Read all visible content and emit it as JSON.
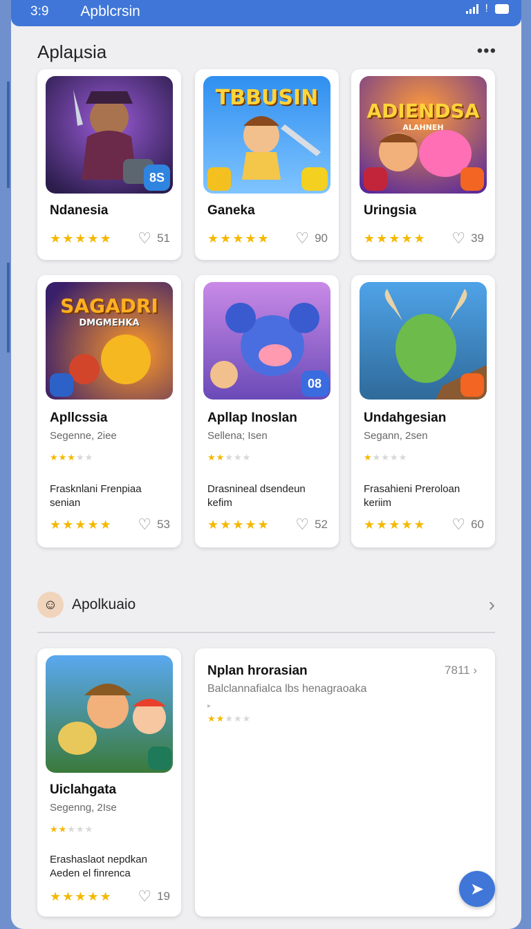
{
  "status": {
    "time": "3:9",
    "app_title": "Apblcrsin"
  },
  "section1": {
    "title": "Aplaµsia",
    "more": "•••"
  },
  "row1": [
    {
      "name": "Ndanesia",
      "stars": "★★★★★",
      "likes": "51",
      "badge": "8S"
    },
    {
      "name": "Ganeka",
      "stars": "★★★★★",
      "likes": "90",
      "title_art": "TBBUSIN"
    },
    {
      "name": "Uringsia",
      "stars": "★★★★★",
      "likes": "39",
      "title_art": "ADIENDSA",
      "title_art_sub": "ALAHNEH"
    }
  ],
  "row2": [
    {
      "name": "Apllcssia",
      "sub": "Segenne, 2iee",
      "small_on": "★★★",
      "small_off": "★★",
      "desc": "Frasknlani Frenpiaa senian",
      "stars": "★★★★★",
      "likes": "53",
      "title_art": "SAGADRI",
      "title_art_sub": "DMGMEHKA"
    },
    {
      "name": "Apllap Inoslan",
      "sub": "Sellena; Isen",
      "small_on": "★★",
      "small_off": "★★★",
      "desc": "Drasnineal dsendeun kefim",
      "stars": "★★★★★",
      "likes": "52",
      "badge": "08"
    },
    {
      "name": "Undahgesian",
      "sub": "Segann, 2sen",
      "small_on": "★",
      "small_off": "★★★★",
      "desc": "Frasahieni Preroloan keriim",
      "stars": "★★★★★",
      "likes": "60"
    }
  ],
  "section2": {
    "label": "Apolkuaio"
  },
  "row3": {
    "card": {
      "name": "Uiclahgata",
      "sub": "Segenng, 2Ise",
      "small_on": "★★",
      "small_off": "★★★",
      "desc": "Erashaslaot nepdkan Aeden el finrenca",
      "stars": "★★★★★",
      "likes": "19"
    },
    "detail": {
      "title": "Nplan hrorasian",
      "count": "7811",
      "subtitle": "Balclannafialca lbs henagraoaka",
      "small_on": "★★",
      "small_off": "★★★"
    }
  },
  "colors": {
    "accent": "#3f76d8",
    "star": "#f5b800",
    "background": "#efeff1"
  },
  "icons": {
    "heart": "♡",
    "chevron": "›",
    "send": "➤"
  }
}
